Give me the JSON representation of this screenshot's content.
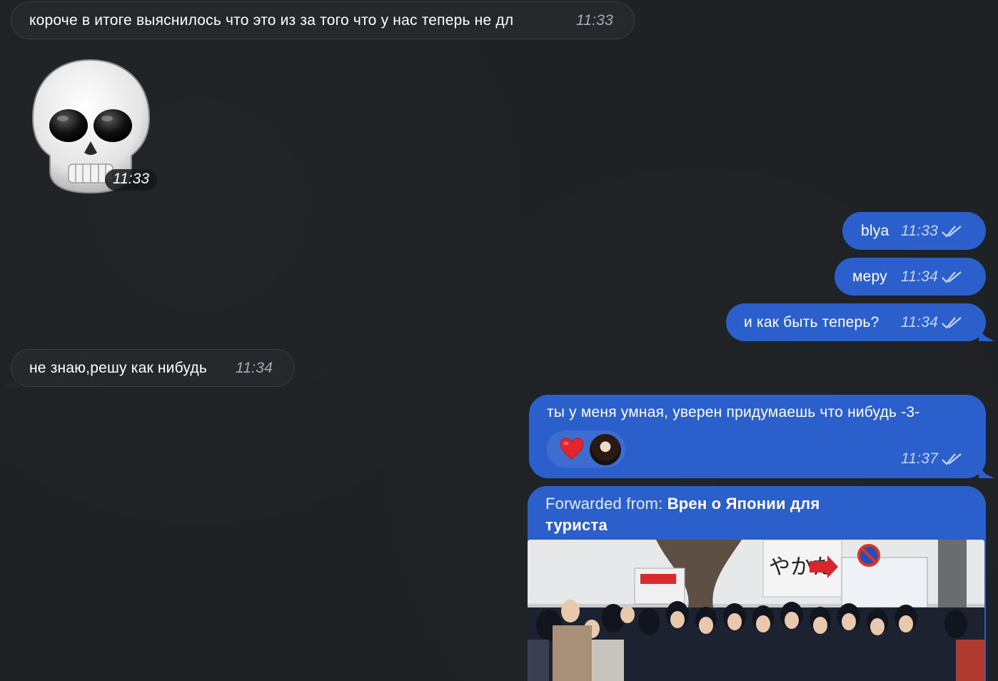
{
  "messages": [
    {
      "text": "короче в итоге выяснилось что это из за того что у нас теперь не дл",
      "time": "11:33"
    },
    {
      "sticker": "skull-emoji",
      "time": "11:33"
    },
    {
      "text": "blya",
      "time": "11:33"
    },
    {
      "text": "меру",
      "time": "11:34"
    },
    {
      "text": "и как быть теперь?",
      "time": "11:34"
    },
    {
      "text": "не знаю,решу как нибудь",
      "time": "11:34"
    },
    {
      "text": "ты у меня умная, уверен придумаешь что нибудь -3-",
      "time": "11:37",
      "reaction": "heart-icon"
    },
    {
      "forward_label": "Forwarded from:",
      "forward_source_line1": "Врен о Японии для",
      "forward_source_line2": "туриста"
    }
  ],
  "colors": {
    "background": "#1f2225",
    "incoming_bubble": "#26292c",
    "outgoing_bubble": "#2b5fcb",
    "reaction_pill": "#3f6ccf"
  },
  "icons": {
    "read_status": "double-check-icon",
    "reaction": "heart-icon",
    "sticker": "skull-emoji"
  }
}
